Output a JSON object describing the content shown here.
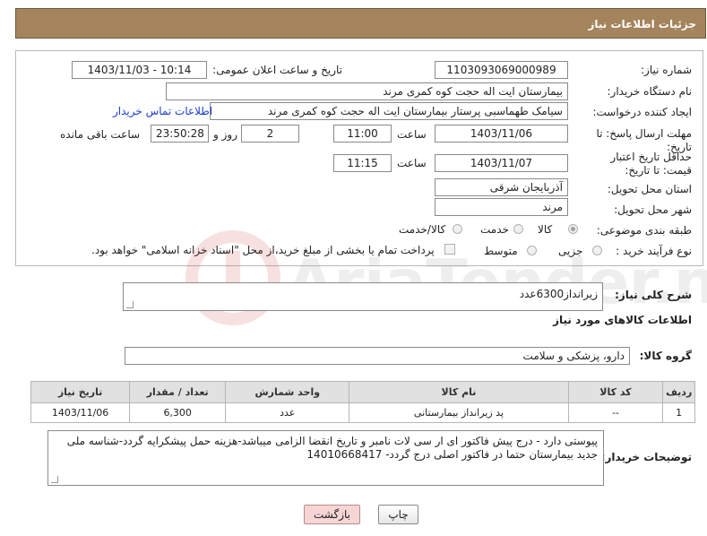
{
  "header": {
    "title": "جزئیات اطلاعات نیاز"
  },
  "labels": {
    "need_number": "شماره نیاز:",
    "announce_datetime": "تاریخ و ساعت اعلان عمومی:",
    "buyer_org": "نام دستگاه خریدار:",
    "requester": "ایجاد کننده درخواست:",
    "contact_link": "اطلاعات تماس خریدار",
    "reply_deadline": "مهلت ارسال پاسخ: تا تاریخ:",
    "time": "ساعت",
    "day_and": "روز و",
    "remaining": "ساعت باقی مانده",
    "price_validity": "حداقل تاریخ اعتبار قیمت: تا تاریخ:",
    "delivery_province": "استان محل تحویل:",
    "delivery_city": "شهر محل تحویل:",
    "category": "طبقه بندی موضوعی:",
    "purchase_type": "نوع فرآیند خرید :",
    "summary": "شرح کلی نیاز:",
    "goods_info": "اطلاعات کالاهای مورد نیاز",
    "goods_group": "گروه کالا:",
    "buyer_notes": "توضیحات خریدار:"
  },
  "values": {
    "need_number": "1103093069000989",
    "announce_datetime": "1403/11/03 - 10:14",
    "buyer_org": "بیمارستان ایت اله حجت کوه کمری مرند",
    "requester": "سیامک طهماسبی پرستار بیمارستان ایت اله حجت کوه کمری مرند",
    "reply_date": "1403/11/06",
    "reply_time": "11:00",
    "reply_days": "2",
    "reply_remaining": "23:50:28",
    "validity_date": "1403/11/07",
    "validity_time": "11:15",
    "province": "آذربایجان شرقی",
    "city": "مرند",
    "summary": "زیرانداز6300عدد",
    "goods_group": "دارو، پزشکی و سلامت",
    "buyer_notes": "پیوستی دارد - درج پیش فاکتور ای ار سی لات نامبر و تاریخ انقضا الزامی میباشد-هزینه حمل پیشکرایه گردد-شناسه ملی جدید بیمارستان حتما در فاکتور اصلی درج  گردد- 14010668417"
  },
  "category_options": [
    {
      "label": "کالا",
      "selected": true
    },
    {
      "label": "خدمت",
      "selected": false
    },
    {
      "label": "کالا/خدمت",
      "selected": false
    }
  ],
  "purchase_options": [
    {
      "label": "جزیی",
      "selected": false
    },
    {
      "label": "متوسط",
      "selected": false
    }
  ],
  "payment_note": "پرداخت تمام یا بخشی از مبلغ خرید،از محل \"اسناد خزانه اسلامی\" خواهد بود.",
  "table": {
    "headers": [
      "ردیف",
      "کد کالا",
      "نام کالا",
      "واحد شمارش",
      "تعداد / مقدار",
      "تاریخ نیاز"
    ],
    "rows": [
      [
        "1",
        "--",
        "پد زیرانداز بیمارستانی",
        "عدد",
        "6,300",
        "1403/11/06"
      ]
    ]
  },
  "buttons": {
    "print": "چاپ",
    "back": "بازگشت"
  },
  "watermark": {
    "text": "AriaTender.net"
  },
  "colors": {
    "header": "#a4845c",
    "link": "#1a3ecf",
    "back_button_bg": "#f7d5d5"
  }
}
